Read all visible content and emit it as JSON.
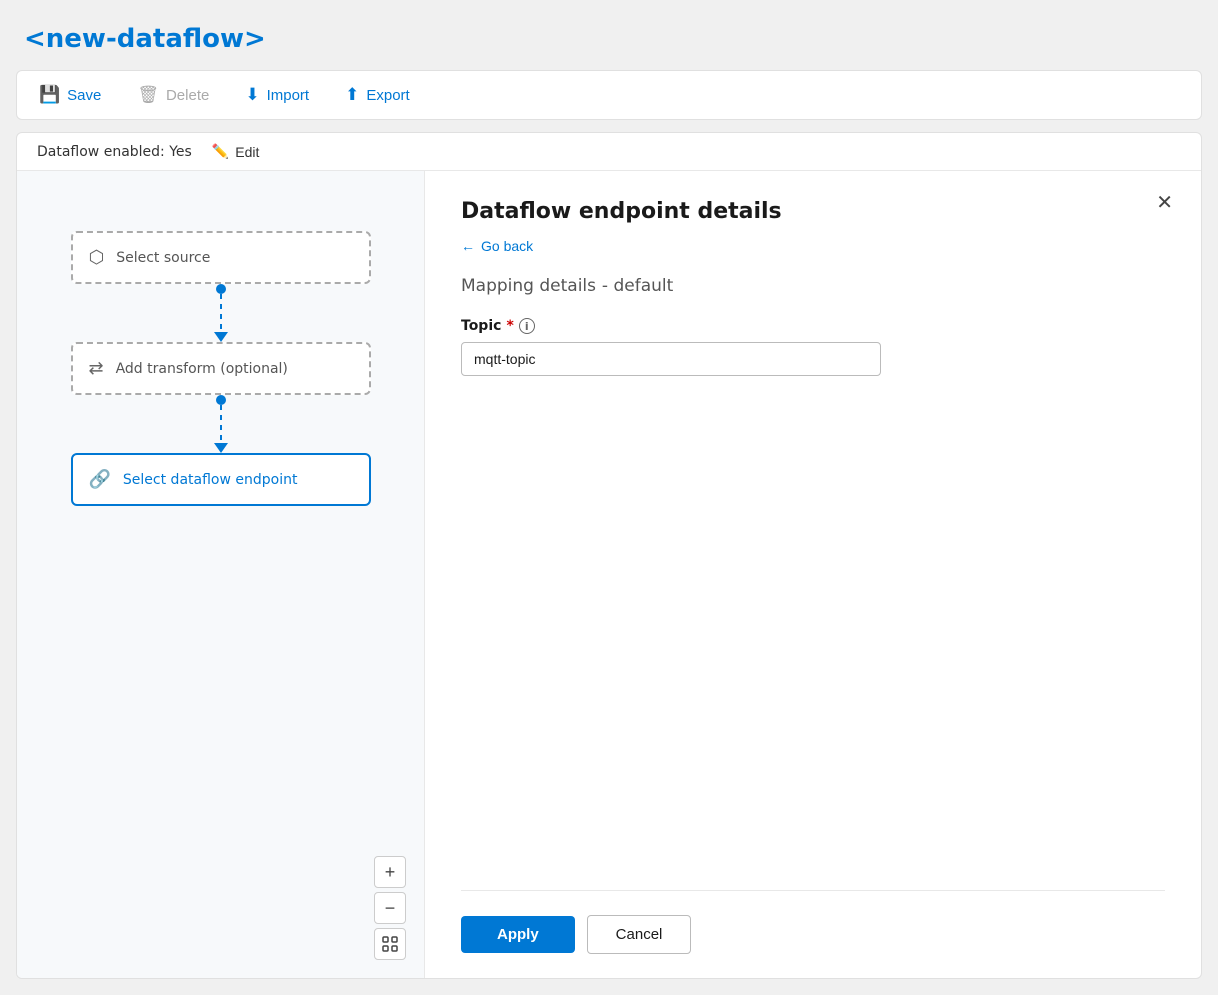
{
  "page": {
    "title": "<new-dataflow>",
    "dataflow_status": "Dataflow enabled: Yes",
    "edit_label": "Edit"
  },
  "toolbar": {
    "save_label": "Save",
    "delete_label": "Delete",
    "import_label": "Import",
    "export_label": "Export"
  },
  "canvas": {
    "select_source_label": "Select source",
    "add_transform_label": "Add transform (optional)",
    "select_endpoint_label": "Select dataflow endpoint",
    "zoom_in_label": "+",
    "zoom_out_label": "−"
  },
  "details_panel": {
    "title": "Dataflow endpoint details",
    "go_back_label": "Go back",
    "mapping_title": "Mapping details",
    "mapping_subtitle": "- default",
    "topic_label": "Topic",
    "topic_required": "*",
    "topic_value": "mqtt-topic",
    "apply_label": "Apply",
    "cancel_label": "Cancel"
  }
}
